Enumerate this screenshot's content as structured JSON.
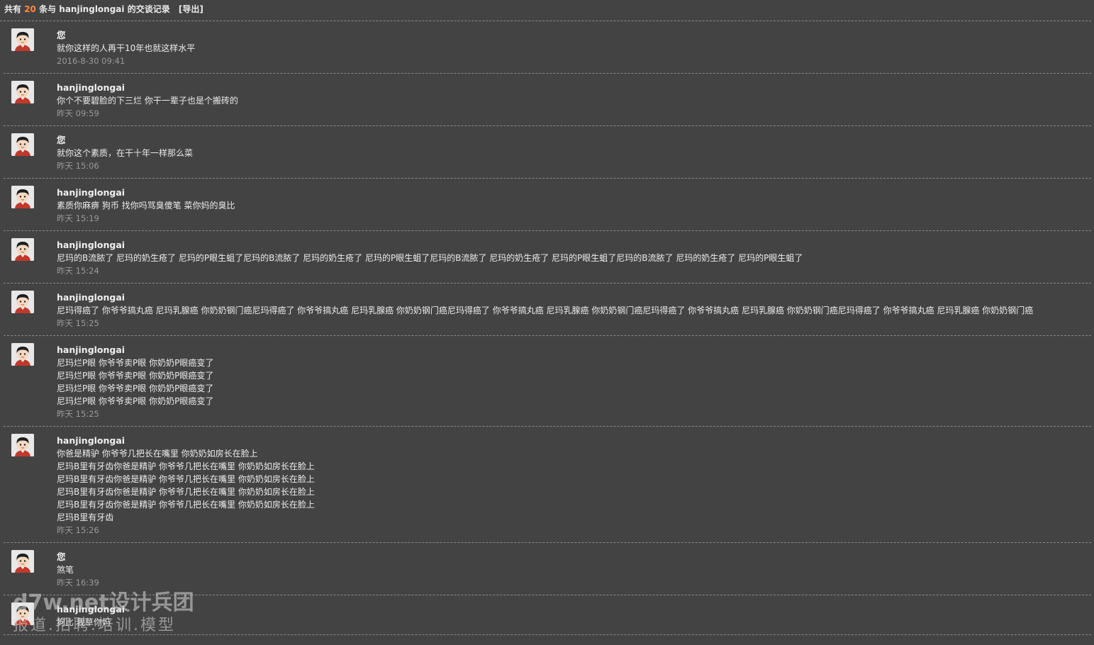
{
  "header": {
    "prefix": "共有",
    "count": "20",
    "suffix": "条与 hanjinglongai 的交谈记录",
    "export_label": "[导出]"
  },
  "messages": [
    {
      "author": "您",
      "lines": [
        "就你这样的人再干10年也就这样水平"
      ],
      "time": "2016-8-30 09:41"
    },
    {
      "author": "hanjinglongai",
      "lines": [
        "你个不要碧脸的下三烂 你干一辈子也是个搬砖的"
      ],
      "time": "昨天 09:59"
    },
    {
      "author": "您",
      "lines": [
        "就你这个素质，在干十年一样那么菜"
      ],
      "time": "昨天 15:06"
    },
    {
      "author": "hanjinglongai",
      "lines": [
        "素质你麻痹 狗币 找你吗骂臭傻笔 菜你妈的臭比"
      ],
      "time": "昨天 15:19"
    },
    {
      "author": "hanjinglongai",
      "lines": [
        "尼玛的B流脓了 尼玛的奶生疮了 尼玛的P眼生蛆了尼玛的B流脓了 尼玛的奶生疮了 尼玛的P眼生蛆了尼玛的B流脓了 尼玛的奶生疮了 尼玛的P眼生蛆了尼玛的B流脓了 尼玛的奶生疮了 尼玛的P眼生蛆了"
      ],
      "time": "昨天 15:24"
    },
    {
      "author": "hanjinglongai",
      "lines": [
        "尼玛得癌了 你爷爷搞丸癌 尼玛乳腺癌 你奶奶钢门癌尼玛得癌了 你爷爷搞丸癌 尼玛乳腺癌 你奶奶钢门癌尼玛得癌了 你爷爷搞丸癌 尼玛乳腺癌 你奶奶钢门癌尼玛得癌了 你爷爷搞丸癌 尼玛乳腺癌 你奶奶钢门癌尼玛得癌了 你爷爷搞丸癌 尼玛乳腺癌 你奶奶钢门癌"
      ],
      "time": "昨天 15:25"
    },
    {
      "author": "hanjinglongai",
      "lines": [
        "尼玛烂P眼 你爷爷卖P眼 你奶奶P眼癌变了",
        "尼玛烂P眼 你爷爷卖P眼 你奶奶P眼癌变了",
        "尼玛烂P眼 你爷爷卖P眼 你奶奶P眼癌变了",
        "尼玛烂P眼 你爷爷卖P眼 你奶奶P眼癌变了"
      ],
      "time": "昨天 15:25"
    },
    {
      "author": "hanjinglongai",
      "lines": [
        "你爸是精驴 你爷爷几把长在嘴里 你奶奶如房长在脸上",
        "尼玛B里有牙齿你爸是精驴 你爷爷几把长在嘴里 你奶奶如房长在脸上",
        "尼玛B里有牙齿你爸是精驴 你爷爷几把长在嘴里 你奶奶如房长在脸上",
        "尼玛B里有牙齿你爸是精驴 你爷爷几把长在嘴里 你奶奶如房长在脸上",
        "尼玛B里有牙齿你爸是精驴 你爷爷几把长在嘴里 你奶奶如房长在脸上",
        "尼玛B里有牙齿"
      ],
      "time": "昨天 15:26"
    },
    {
      "author": "您",
      "lines": [
        "煞笔"
      ],
      "time": "昨天 16:39"
    },
    {
      "author": "hanjinglongai",
      "lines": [
        "狗比 我草你妈"
      ],
      "time": ""
    }
  ],
  "watermark": {
    "line1": "d7w.net设计兵团",
    "line2": "报道.招聘.培训.模型"
  },
  "colors": {
    "background": "#434343",
    "count_accent": "#ff8a3d",
    "timestamp": "#9a9a9a",
    "divider": "#8a8a8a"
  },
  "icons": {
    "avatar": "user-avatar-icon"
  }
}
